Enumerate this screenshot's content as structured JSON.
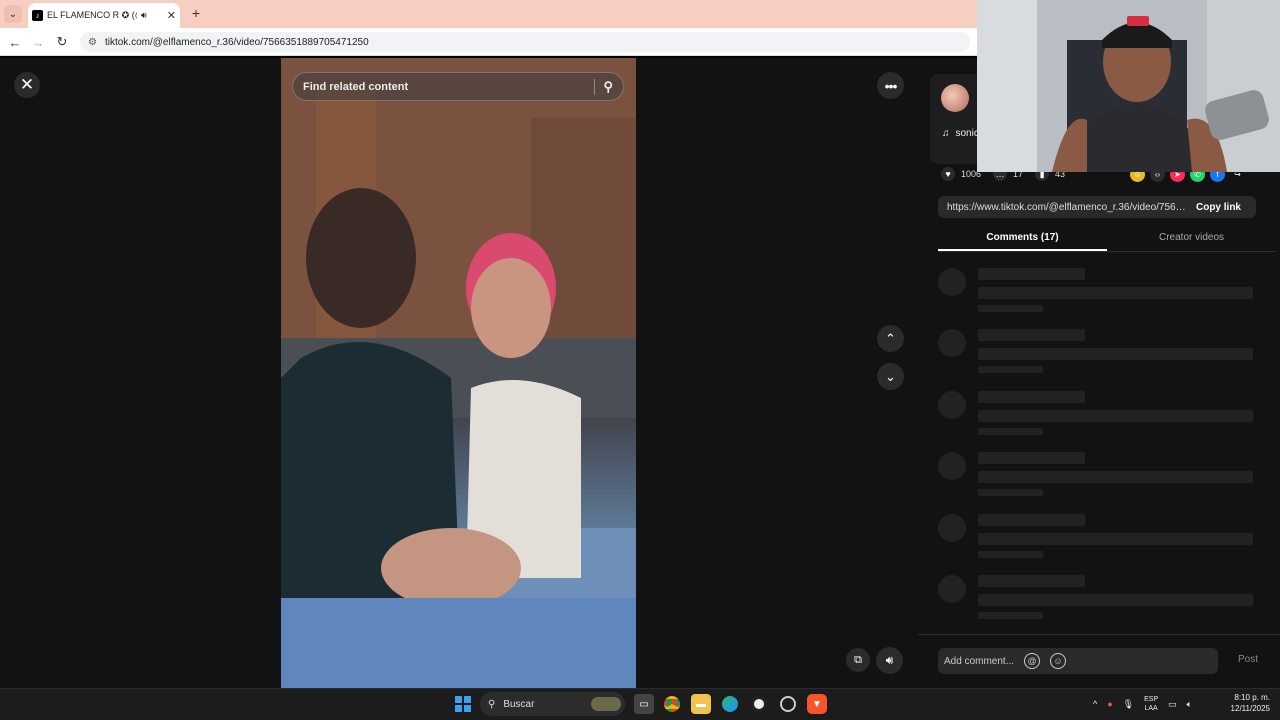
{
  "browser": {
    "tab_title": "EL FLAMENCO R ✪ (@elfl",
    "tab_close": "✕",
    "new_tab": "+",
    "url": "tiktok.com/@elflamenco_r.36/video/7566351889705471250"
  },
  "player": {
    "search_placeholder": "Find related content"
  },
  "panel": {
    "sound_label": "sonic",
    "likes": "1006",
    "comments_count": "17",
    "saves": "43",
    "share_url": "https://www.tiktok.com/@elflamenco_r.36/video/7566...",
    "copy_link": "Copy link",
    "tab_comments": "Comments (17)",
    "tab_creator": "Creator videos",
    "comment_placeholder": "Add comment...",
    "post": "Post"
  },
  "taskbar": {
    "search_label": "Buscar",
    "lang_line1": "ESP",
    "lang_line2": "LAA",
    "time": "8:10 p. m.",
    "date": "12/11/2025"
  },
  "colors": {
    "background": "#121212",
    "tab_bar": "#f7cfc2",
    "accent_tiktok": "#fe2c55"
  }
}
